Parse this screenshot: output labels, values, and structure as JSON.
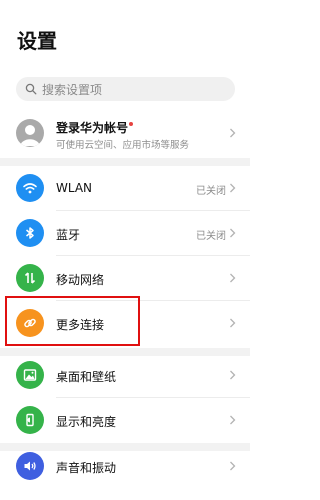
{
  "header": {
    "title": "设置"
  },
  "search": {
    "placeholder": "搜索设置项"
  },
  "account": {
    "title": "登录华为帐号",
    "subtitle": "可使用云空间、应用市场等服务"
  },
  "rows": [
    {
      "label": "WLAN",
      "value": "已关闭",
      "icon": "wifi-icon",
      "color": "#1f8ff2"
    },
    {
      "label": "蓝牙",
      "value": "已关闭",
      "icon": "bluetooth-icon",
      "color": "#1f8ff2"
    },
    {
      "label": "移动网络",
      "value": "",
      "icon": "mobile-data-icon",
      "color": "#35b34a"
    },
    {
      "label": "更多连接",
      "value": "",
      "icon": "link-icon",
      "color": "#f7931e"
    },
    {
      "label": "桌面和壁纸",
      "value": "",
      "icon": "wallpaper-icon",
      "color": "#35b34a"
    },
    {
      "label": "显示和亮度",
      "value": "",
      "icon": "display-icon",
      "color": "#35b34a"
    },
    {
      "label": "声音和振动",
      "value": "",
      "icon": "sound-icon",
      "color": "#3f5fe0"
    }
  ],
  "colors": {
    "accent_blue": "#1f8ff2",
    "accent_green": "#35b34a",
    "accent_orange": "#f7931e",
    "accent_indigo": "#3f5fe0",
    "highlight_red": "#e01010",
    "badge_red": "#e64340"
  }
}
